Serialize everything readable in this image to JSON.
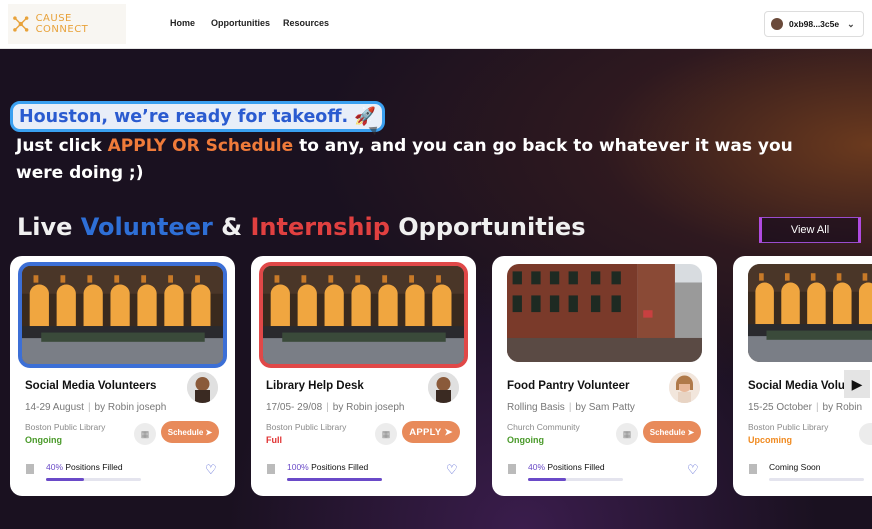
{
  "header": {
    "logo_text": "CAUSE CONNECT",
    "nav": [
      "Home",
      "Opportunities",
      "Resources"
    ],
    "wallet": "0xb98...3c5e"
  },
  "hero": {
    "pill_text": "Houston, we’re ready for takeoff. 🚀",
    "sub_before": "Just click ",
    "sub_highlight": "APPLY OR Schedule",
    "sub_after": " to any, and you can go back to whatever it was you were doing ;)"
  },
  "section": {
    "title_live": "Live ",
    "title_volunteer": "Volunteer",
    "title_amp": " & ",
    "title_internship": "Internship",
    "title_rest": " Opportunities",
    "view_all": "View All"
  },
  "cards": [
    {
      "title": "Social Media Volunteers",
      "date": "14-29 August",
      "by": "by Robin joseph",
      "org": "Boston Public Library",
      "status": "Ongoing",
      "action": "Schedule",
      "pct": "40%",
      "filled_label": " Positions Filled",
      "progress": 0.4
    },
    {
      "title": "Library Help Desk",
      "date": "17/05- 29/08",
      "by": "by Robin joseph",
      "org": "Boston Public Library",
      "status": "Full",
      "action": "APPLY",
      "pct": "100%",
      "filled_label": " Positions Filled",
      "progress": 1.0
    },
    {
      "title": "Food Pantry Volunteer",
      "date": "Rolling Basis",
      "by": "by Sam Patty",
      "org": "Church Community",
      "status": "Ongoing",
      "action": "Schedule",
      "pct": "40%",
      "filled_label": " Positions Filled",
      "progress": 0.4
    },
    {
      "title": "Social Media Volu",
      "date": "15-25 October",
      "by": "by Robin",
      "org": "Boston Public Library",
      "status": "Upcoming",
      "action": "",
      "pct": "",
      "filled_label": "Coming Soon",
      "progress": 0
    }
  ]
}
